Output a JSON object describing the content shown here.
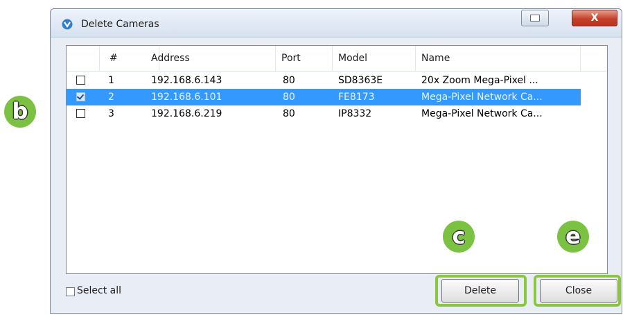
{
  "window": {
    "title": "Delete Cameras",
    "close_glyph": "X"
  },
  "table": {
    "columns": [
      "#",
      "Address",
      "Port",
      "Model",
      "Name"
    ],
    "rows": [
      {
        "checked": false,
        "num": "1",
        "address": "192.168.6.143",
        "port": "80",
        "model": "SD8363E",
        "name": "20x Zoom Mega-Pixel ...",
        "selected": false
      },
      {
        "checked": true,
        "num": "2",
        "address": "192.168.6.101",
        "port": "80",
        "model": "FE8173",
        "name": "Mega-Pixel Network Ca...",
        "selected": true
      },
      {
        "checked": false,
        "num": "3",
        "address": "192.168.6.219",
        "port": "80",
        "model": "IP8332",
        "name": "Mega-Pixel Network Ca...",
        "selected": false
      }
    ]
  },
  "footer": {
    "select_all_label": "Select all",
    "delete_label": "Delete",
    "close_label": "Close"
  },
  "callouts": {
    "b": "b",
    "c": "c",
    "e": "e"
  },
  "colors": {
    "selection": "#3399ff",
    "callout": "#7cc242",
    "highlight": "#8cc63f"
  }
}
